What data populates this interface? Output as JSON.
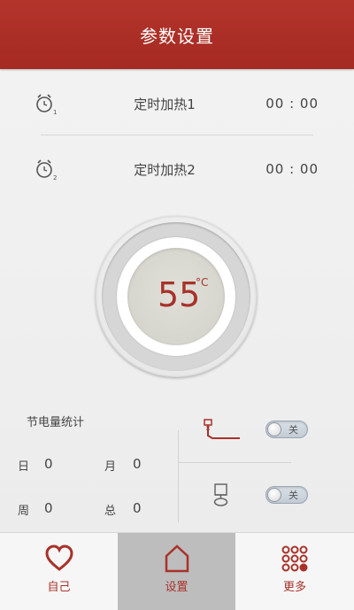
{
  "header": {
    "title": "参数设置"
  },
  "timers": [
    {
      "label": "定时加热1",
      "time": "00 : 00",
      "icon": "alarm-clock-1-icon"
    },
    {
      "label": "定时加热2",
      "time": "00 : 00",
      "icon": "alarm-clock-2-icon"
    }
  ],
  "temperature": {
    "value": "55",
    "unit": "°C"
  },
  "stats": {
    "title": "节电量统计",
    "day_label": "日",
    "day_value": "0",
    "month_label": "月",
    "month_value": "0",
    "week_label": "周",
    "week_value": "0",
    "total_label": "总",
    "total_value": "0"
  },
  "switches": [
    {
      "icon": "heating-element-icon",
      "state": "关"
    },
    {
      "icon": "water-heater-icon",
      "state": "关"
    }
  ],
  "tabs": [
    {
      "label": "自己",
      "icon": "heart-icon",
      "active": false
    },
    {
      "label": "设置",
      "icon": "home-icon",
      "active": true
    },
    {
      "label": "更多",
      "icon": "grid-dots-icon",
      "active": false
    }
  ],
  "colors": {
    "accent": "#a8322a",
    "header": "#ad2f27",
    "active_tab": "#bdbdbd"
  }
}
